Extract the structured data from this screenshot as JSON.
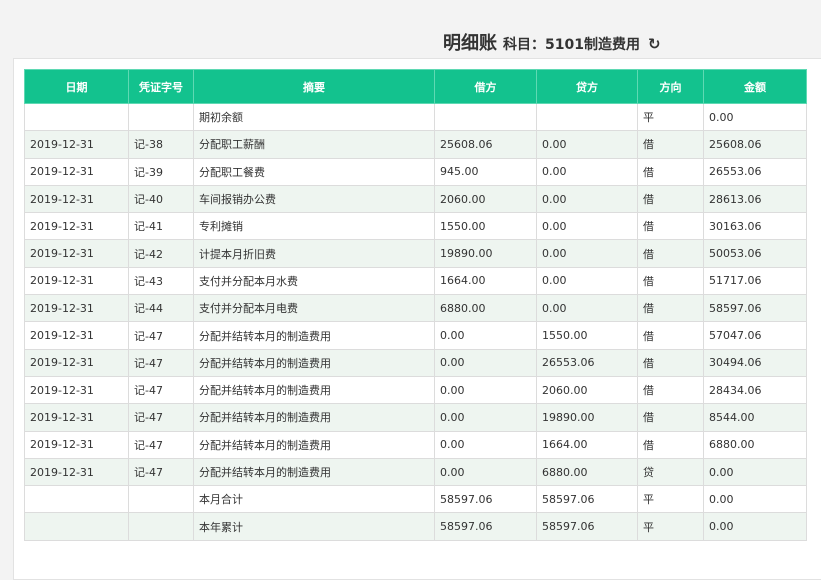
{
  "header": {
    "title": "明细账",
    "subject": "科目：5101制造费用",
    "refresh_icon": "refresh-icon",
    "refresh_glyph": "↻"
  },
  "colors": {
    "header_bg": "#13c28e",
    "alt_row": "#eef5f0"
  },
  "table": {
    "columns": [
      "日期",
      "凭证字号",
      "摘要",
      "借方",
      "贷方",
      "方向",
      "金额"
    ],
    "rows": [
      [
        "",
        "",
        "期初余额",
        "",
        "",
        "平",
        "0.00"
      ],
      [
        "2019-12-31",
        "记-38",
        "分配职工薪酬",
        "25608.06",
        "0.00",
        "借",
        "25608.06"
      ],
      [
        "2019-12-31",
        "记-39",
        "分配职工餐费",
        "945.00",
        "0.00",
        "借",
        "26553.06"
      ],
      [
        "2019-12-31",
        "记-40",
        "车间报销办公费",
        "2060.00",
        "0.00",
        "借",
        "28613.06"
      ],
      [
        "2019-12-31",
        "记-41",
        "专利摊销",
        "1550.00",
        "0.00",
        "借",
        "30163.06"
      ],
      [
        "2019-12-31",
        "记-42",
        "计提本月折旧费",
        "19890.00",
        "0.00",
        "借",
        "50053.06"
      ],
      [
        "2019-12-31",
        "记-43",
        "支付并分配本月水费",
        "1664.00",
        "0.00",
        "借",
        "51717.06"
      ],
      [
        "2019-12-31",
        "记-44",
        "支付并分配本月电费",
        "6880.00",
        "0.00",
        "借",
        "58597.06"
      ],
      [
        "2019-12-31",
        "记-47",
        "分配并结转本月的制造费用",
        "0.00",
        "1550.00",
        "借",
        "57047.06"
      ],
      [
        "2019-12-31",
        "记-47",
        "分配并结转本月的制造费用",
        "0.00",
        "26553.06",
        "借",
        "30494.06"
      ],
      [
        "2019-12-31",
        "记-47",
        "分配并结转本月的制造费用",
        "0.00",
        "2060.00",
        "借",
        "28434.06"
      ],
      [
        "2019-12-31",
        "记-47",
        "分配并结转本月的制造费用",
        "0.00",
        "19890.00",
        "借",
        "8544.00"
      ],
      [
        "2019-12-31",
        "记-47",
        "分配并结转本月的制造费用",
        "0.00",
        "1664.00",
        "借",
        "6880.00"
      ],
      [
        "2019-12-31",
        "记-47",
        "分配并结转本月的制造费用",
        "0.00",
        "6880.00",
        "贷",
        "0.00"
      ],
      [
        "",
        "",
        "本月合计",
        "58597.06",
        "58597.06",
        "平",
        "0.00"
      ],
      [
        "",
        "",
        "本年累计",
        "58597.06",
        "58597.06",
        "平",
        "0.00"
      ]
    ]
  }
}
